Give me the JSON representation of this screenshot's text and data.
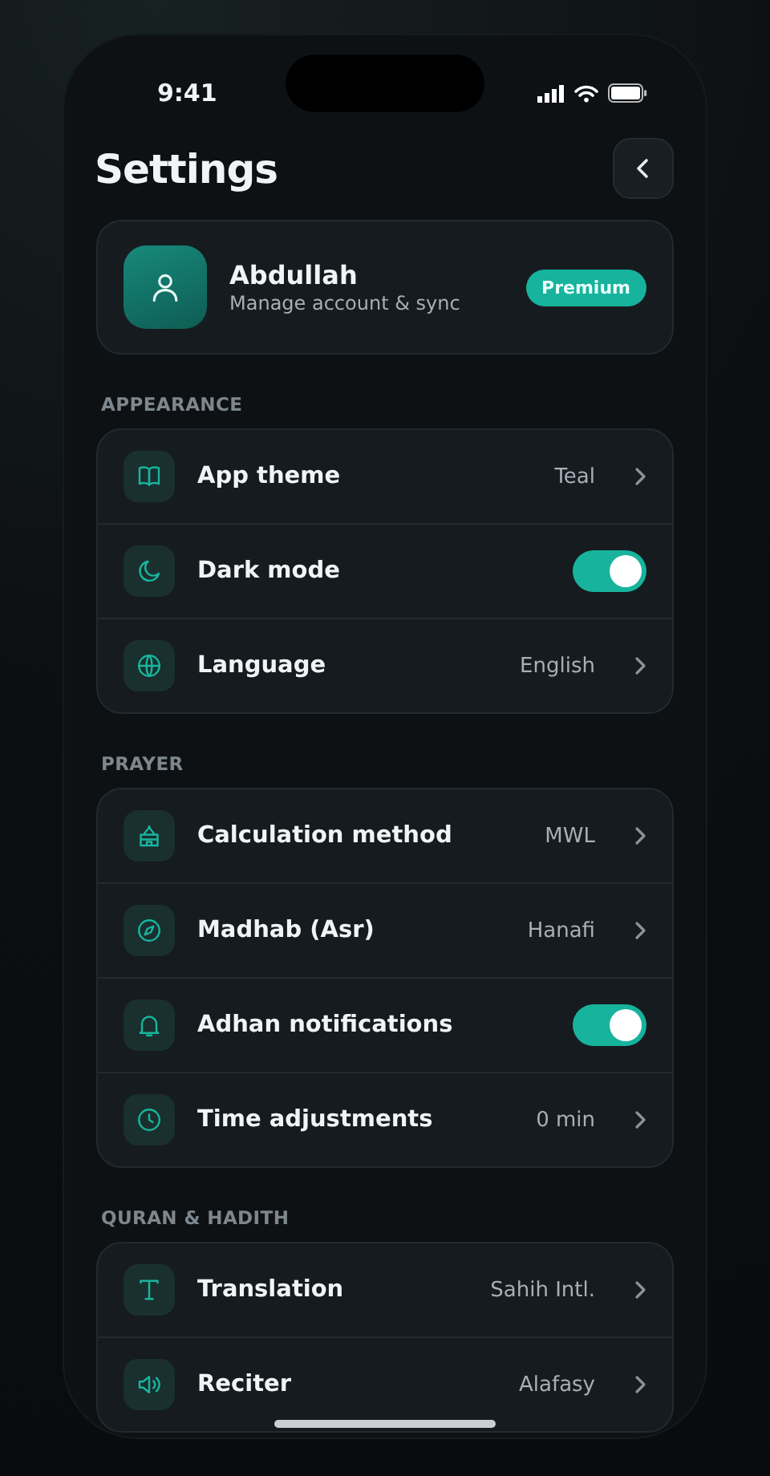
{
  "status_bar": {
    "time": "9:41"
  },
  "header": {
    "title": "Settings"
  },
  "profile": {
    "name": "Abdullah",
    "subtitle": "Manage account & sync",
    "badge": "Premium"
  },
  "sections": [
    {
      "title": "APPEARANCE",
      "rows": [
        {
          "kind": "link",
          "label": "App theme",
          "value": "Teal"
        },
        {
          "kind": "toggle",
          "label": "Dark mode",
          "on": true
        },
        {
          "kind": "link",
          "label": "Language",
          "value": "English"
        }
      ]
    },
    {
      "title": "PRAYER",
      "rows": [
        {
          "kind": "link",
          "label": "Calculation method",
          "value": "MWL"
        },
        {
          "kind": "link",
          "label": "Madhab (Asr)",
          "value": "Hanafi"
        },
        {
          "kind": "toggle",
          "label": "Adhan notifications",
          "on": true
        },
        {
          "kind": "link",
          "label": "Time adjustments",
          "value": "0 min"
        }
      ]
    },
    {
      "title": "QURAN & HADITH",
      "rows": [
        {
          "kind": "link",
          "label": "Translation",
          "value": "Sahih Intl."
        },
        {
          "kind": "link",
          "label": "Reciter",
          "value": "Alafasy"
        }
      ]
    }
  ]
}
